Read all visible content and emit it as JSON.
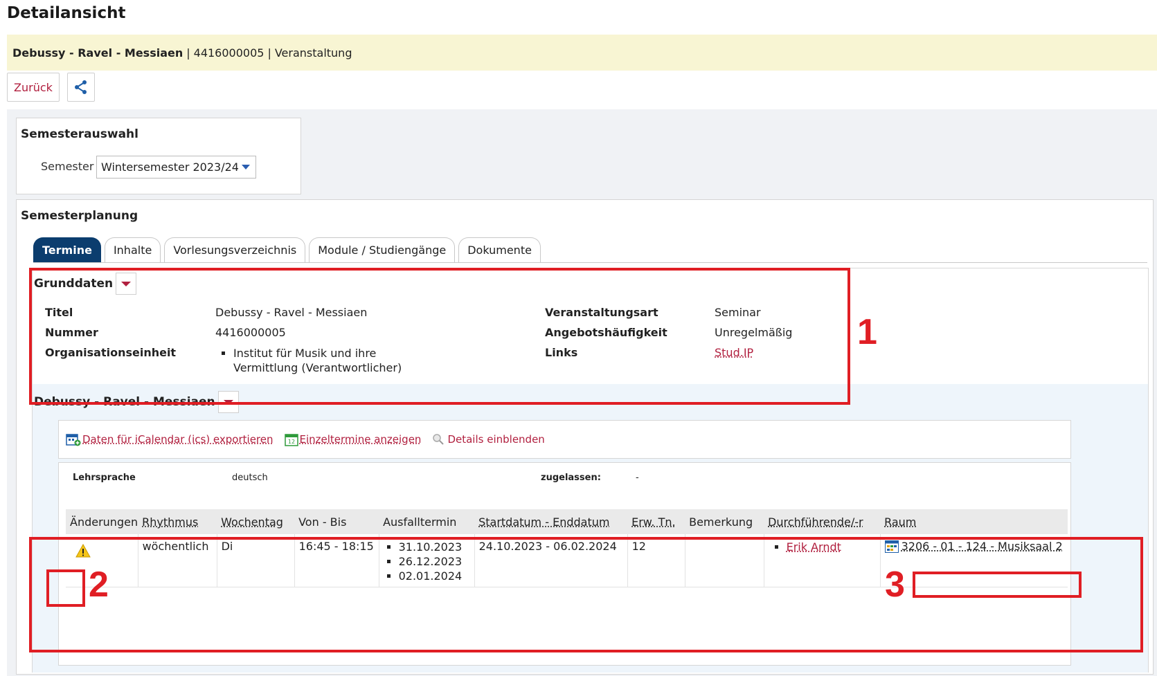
{
  "page": {
    "title": "Detailansicht"
  },
  "info_bar": {
    "course_title": "Debussy - Ravel - Messiaen",
    "number": "4416000005",
    "separator": "|",
    "type": "Veranstaltung"
  },
  "toolbar": {
    "back_label": "Zurück",
    "share_icon": "share-icon"
  },
  "semester": {
    "heading": "Semesterauswahl",
    "label": "Semester",
    "selected": "Wintersemester 2023/24"
  },
  "planning": {
    "heading": "Semesterplanung",
    "tabs": [
      {
        "label": "Termine",
        "active": true
      },
      {
        "label": "Inhalte",
        "active": false
      },
      {
        "label": "Vorlesungsverzeichnis",
        "active": false
      },
      {
        "label": "Module / Studiengänge",
        "active": false
      },
      {
        "label": "Dokumente",
        "active": false
      }
    ]
  },
  "grunddaten": {
    "heading": "Grunddaten",
    "titel_label": "Titel",
    "titel_value": "Debussy - Ravel - Messiaen",
    "nummer_label": "Nummer",
    "nummer_value": "4416000005",
    "org_label": "Organisationseinheit",
    "org_value": "Institut für Musik und ihre Vermittlung (Verantwortlicher)",
    "art_label": "Veranstaltungsart",
    "art_value": "Seminar",
    "freq_label": "Angebotshäufigkeit",
    "freq_value": "Unregelmäßig",
    "links_label": "Links",
    "links_value": "Stud.IP"
  },
  "annotations": {
    "one": "1",
    "two": "2",
    "three": "3",
    "color": "#e01e24"
  },
  "course": {
    "heading": "Debussy - Ravel - Messiaen",
    "actions": {
      "ical": "Daten für iCalendar (ics) exportieren",
      "single": "Einzeltermine anzeigen",
      "details": "Details einblenden"
    },
    "lehrsprache_label": "Lehrsprache",
    "lehrsprache_value": "deutsch",
    "zugelassen_label": "zugelassen:",
    "zugelassen_value": "-",
    "table": {
      "headers": [
        "Änderungen",
        "Rhythmus",
        "Wochentag",
        "Von - Bis",
        "Ausfalltermin",
        "Startdatum - Enddatum",
        "Erw. Tn.",
        "Bemerkung",
        "Durchführende/-r",
        "Raum"
      ],
      "row": {
        "rhythmus": "wöchentlich",
        "wochentag": "Di",
        "von_bis": "16:45 - 18:15",
        "ausfall": [
          "31.10.2023",
          "26.12.2023",
          "02.01.2024"
        ],
        "start_end": "24.10.2023 - 06.02.2024",
        "erw_tn": "12",
        "bemerkung": "",
        "person": "Erik Arndt",
        "raum": "3206 - 01 - 124 - Musiksaal 2"
      }
    }
  },
  "colors": {
    "accent": "#b1203f",
    "tab_active": "#0b3d6e",
    "info_bar": "#f8f5d3"
  }
}
